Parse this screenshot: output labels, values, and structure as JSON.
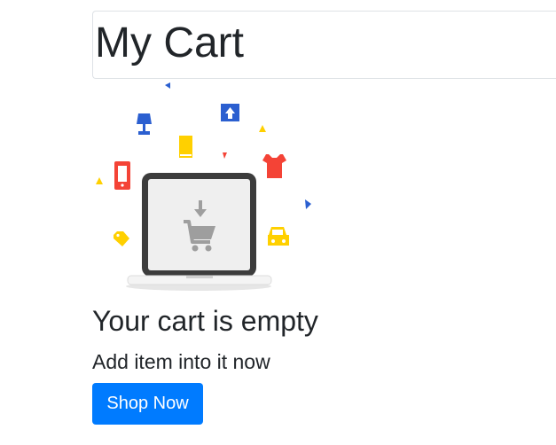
{
  "header": {
    "title": "My Cart"
  },
  "empty_state": {
    "illustration_icon": "empty-cart-laptop-illustration",
    "heading": "Your cart is empty",
    "subtext": "Add item into it now",
    "button_label": "Shop Now"
  },
  "colors": {
    "primary": "#007bff",
    "illustration_blue": "#2b5fd0",
    "illustration_yellow": "#ffd000",
    "illustration_red": "#f44336",
    "illustration_gray": "#9e9e9e"
  }
}
